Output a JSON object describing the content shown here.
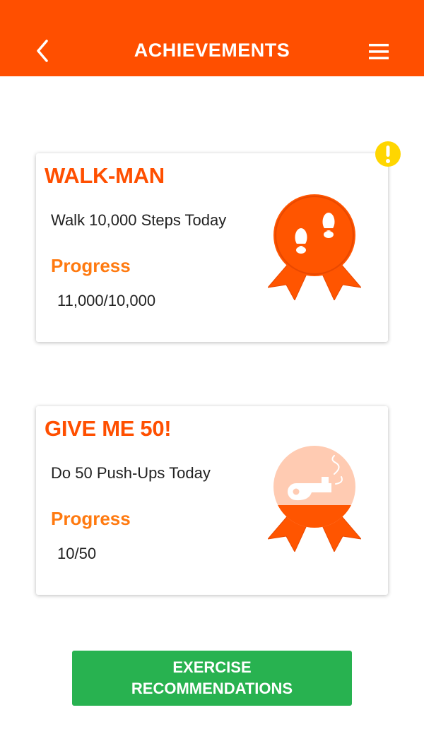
{
  "header": {
    "title": "ACHIEVEMENTS",
    "back_icon": "chevron-left-icon",
    "menu_icon": "hamburger-menu-icon",
    "background_color": "#ff4f00"
  },
  "achievements": [
    {
      "title": "WALK-MAN",
      "description": "Walk 10,000 Steps Today",
      "progress_label": "Progress",
      "progress_value": "11,000/10,000",
      "badge_icon": "footprints-icon",
      "completed": true,
      "alert_icon": "exclamation-alert-icon"
    },
    {
      "title": "GIVE ME 50!",
      "description": "Do 50 Push-Ups Today",
      "progress_label": "Progress",
      "progress_value": "10/50",
      "badge_icon": "whistle-icon",
      "completed": false,
      "badge_fill_fraction": 0.2
    }
  ],
  "cta": {
    "label": "EXERCISE RECOMMENDATIONS",
    "color": "#28b250"
  },
  "colors": {
    "accent": "#ff4f00",
    "progress_label": "#ff7a10",
    "alert": "#ffd600"
  }
}
